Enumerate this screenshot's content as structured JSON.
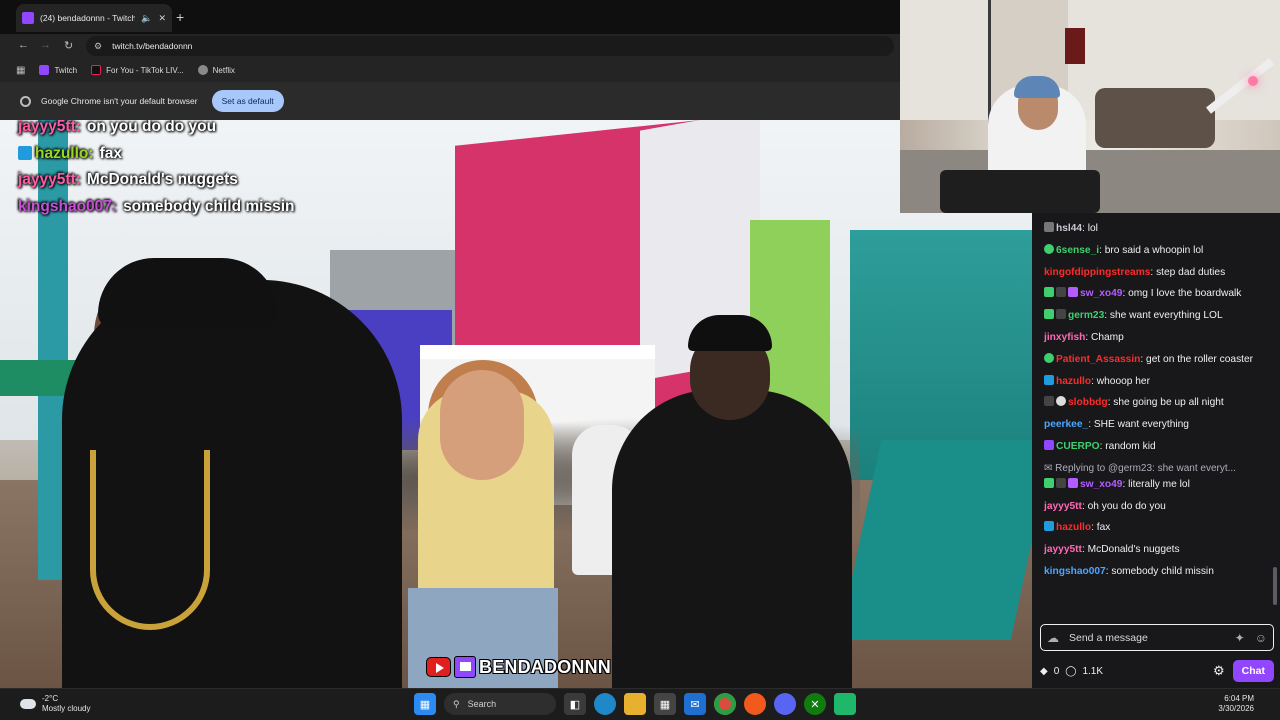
{
  "browser": {
    "tab_title": "(24) bendadonnn - Twitch",
    "new_tab": "+",
    "url": "twitch.tv/bendadonnn",
    "bookmarks": [
      {
        "label": "Twitch",
        "icon": "twitch-icon",
        "color": "#9146ff"
      },
      {
        "label": "For You - TikTok LIV...",
        "icon": "tiktok-icon",
        "color": "#111111"
      },
      {
        "label": "Netflix",
        "icon": "globe-icon",
        "color": "#8a8a8a"
      }
    ],
    "infobar": {
      "message": "Google Chrome isn't your default browser",
      "button": "Set as default"
    }
  },
  "overlay_chat": [
    {
      "user": "jayyy5tt:",
      "text": "on you do do you",
      "color": "#ff5aa8"
    },
    {
      "user": "hazullo:",
      "text": "fax",
      "color": "#9bd81d"
    },
    {
      "user": "jayyy5tt:",
      "text": "McDonald's nuggets",
      "color": "#ff5aa8"
    },
    {
      "user": "kingshao007:",
      "text": "somebody child missin",
      "color": "#c64fd6"
    }
  ],
  "brand_watermark": "BENDADONNN",
  "chat": {
    "messages": [
      {
        "user": "hsl44",
        "text": ": lol",
        "color": "#c8c8d0"
      },
      {
        "user": "6sense_i",
        "text": ": bro said a whoopin lol",
        "color": "#3ecf6e"
      },
      {
        "user": "kingofdippingstreams",
        "text": ": step dad duties",
        "color": "#ff2a2a"
      },
      {
        "user": "sw_xo49",
        "text": ": omg I love the boardwalk",
        "color": "#b45cff"
      },
      {
        "user": "germ23",
        "text": ": she want everything LOL",
        "color": "#3ecf6e"
      },
      {
        "user": "jinxyfish",
        "text": ": Champ",
        "color": "#ff69b4"
      },
      {
        "user": "Patient_Assassin",
        "text": ": get on the roller coaster",
        "color": "#ff2a2a"
      },
      {
        "user": "hazullo",
        "text": ": whooop her",
        "color": "#ff2a2a"
      },
      {
        "user": "slobbdg",
        "text": ": she going be up all night",
        "color": "#ff2a2a"
      },
      {
        "user": "peerkee_",
        "text": ": SHE want everything",
        "color": "#4da6ff"
      },
      {
        "user": "CUERPO",
        "text": ": random kid",
        "color": "#3ecf6e"
      }
    ],
    "reply_to": "Replying to @germ23: she want everyt...",
    "messages_after": [
      {
        "user": "sw_xo49",
        "text": ": literally me lol",
        "color": "#b45cff"
      },
      {
        "user": "jayyy5tt",
        "text": ": oh you do do you",
        "color": "#ff69b4"
      },
      {
        "user": "hazullo",
        "text": ": fax",
        "color": "#ff2a2a"
      },
      {
        "user": "jayyy5tt",
        "text": ": McDonald's nuggets",
        "color": "#ff69b4"
      },
      {
        "user": "kingshao007",
        "text": ": somebody child missin",
        "color": "#4da6ff"
      }
    ],
    "input_placeholder": "Send a message",
    "points": "0",
    "views": "1.1K",
    "chat_button": "Chat"
  },
  "taskbar": {
    "temp": "-2°C",
    "weather": "Mostly cloudy",
    "search": "Search",
    "time": "6:04 PM",
    "date": "3/30/2026"
  }
}
